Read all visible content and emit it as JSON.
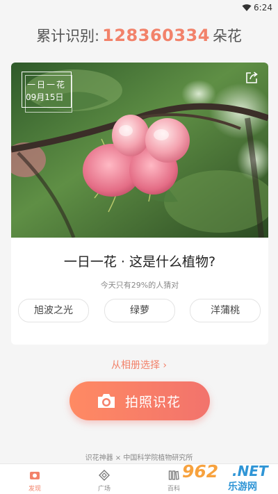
{
  "status_bar": {
    "time": "6:24"
  },
  "counter": {
    "prefix": "累计识别:",
    "value": "128360334",
    "suffix": "朵花"
  },
  "daily_card": {
    "stamp_title": "一日一花",
    "stamp_date": "09月15日",
    "question": "一日一花 · 这是什么植物?",
    "hint": "今天只有29%的人猜对",
    "options": [
      "旭波之光",
      "绿萝",
      "洋蒲桃"
    ]
  },
  "album_link": "从相册选择 ›",
  "shoot_button": {
    "label": "拍照识花"
  },
  "footer_note": "识花神器 × 中国科学院植物研究所",
  "tabs": [
    {
      "label": "发现",
      "icon": "camera-icon",
      "active": true
    },
    {
      "label": "广场",
      "icon": "diamond-icon",
      "active": false
    },
    {
      "label": "百科",
      "icon": "books-icon",
      "active": false
    }
  ],
  "watermark": {
    "num": "962",
    "net": ".NET",
    "cn": "乐游网"
  },
  "colors": {
    "accent": "#f2826a",
    "button_start": "#ff8a63",
    "button_end": "#f2736c",
    "background": "#f5f5f5"
  }
}
